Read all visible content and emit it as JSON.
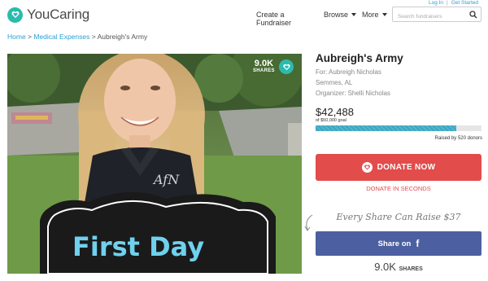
{
  "header": {
    "brand": "YouCaring",
    "top_links": {
      "login": "Log In",
      "separator": "|",
      "get_started": "Get Started"
    },
    "nav": {
      "create": "Create a Fundraiser",
      "browse": "Browse",
      "more": "More"
    },
    "search": {
      "placeholder": "Search fundraisers",
      "icon": "search-icon"
    }
  },
  "breadcrumb": {
    "home": "Home",
    "separator": " > ",
    "category": "Medical Expenses",
    "current": "Aubreigh's Army"
  },
  "hero": {
    "share_count": "9.0K",
    "share_label": "SHARES",
    "sign_text": "First Day"
  },
  "campaign": {
    "title": "Aubreigh's Army",
    "for_line": "For: Aubreigh Nicholas",
    "location": "Semmes, AL",
    "organizer": "Organizer: Shelli Nicholas",
    "raised": "$42,488",
    "goal_line": "of $50,000 goal",
    "progress_fraction": 0.85,
    "donors_line": "Raised by 520 donors"
  },
  "actions": {
    "donate_label": "DONATE NOW",
    "donate_seconds": "DONATE IN SECONDS",
    "every_share": "Every Share Can Raise $37",
    "share_on": "Share on",
    "facebook_glyph": "f",
    "shares_num": "9.0K",
    "shares_label": "SHARES"
  },
  "colors": {
    "brand_teal": "#2bbbad",
    "link_blue": "#2a9fd6",
    "donate_red": "#e24c4b",
    "facebook_blue": "#4c5fa0",
    "progress_blue": "#3aa6c4"
  }
}
